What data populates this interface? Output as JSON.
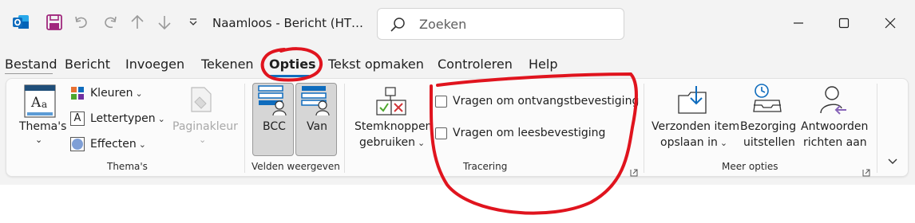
{
  "window": {
    "title": "Naamloos  -  Bericht (HT…"
  },
  "search": {
    "placeholder": "Zoeken"
  },
  "tabs": [
    "Bestand",
    "Bericht",
    "Invoegen",
    "Tekenen",
    "Opties",
    "Tekst opmaken",
    "Controleren",
    "Help"
  ],
  "active_tab": "Opties",
  "accent_color": "#0f6cbd",
  "annotation_color": "#e0141e",
  "groups": {
    "themas": {
      "label": "Thema's",
      "themas_button": "Thema's",
      "kleuren": "Kleuren",
      "lettertypen": "Lettertypen",
      "effecten": "Effecten",
      "paginakleur": "Paginakleur"
    },
    "velden": {
      "label": "Velden weergeven",
      "bcc": "BCC",
      "van": "Van"
    },
    "stemknoppen": {
      "line1": "Stemknoppen",
      "line2": "gebruiken"
    },
    "tracering": {
      "label": "Tracering",
      "ontvangst": "Vragen om ontvangstbevestiging",
      "lees": "Vragen om leesbevestiging"
    },
    "meer_opties": {
      "label": "Meer opties",
      "verzonden_line1": "Verzonden item",
      "verzonden_line2": "opslaan in",
      "bezorging_line1": "Bezorging",
      "bezorging_line2": "uitstellen",
      "antwoorden_line1": "Antwoorden",
      "antwoorden_line2": "richten aan"
    }
  }
}
